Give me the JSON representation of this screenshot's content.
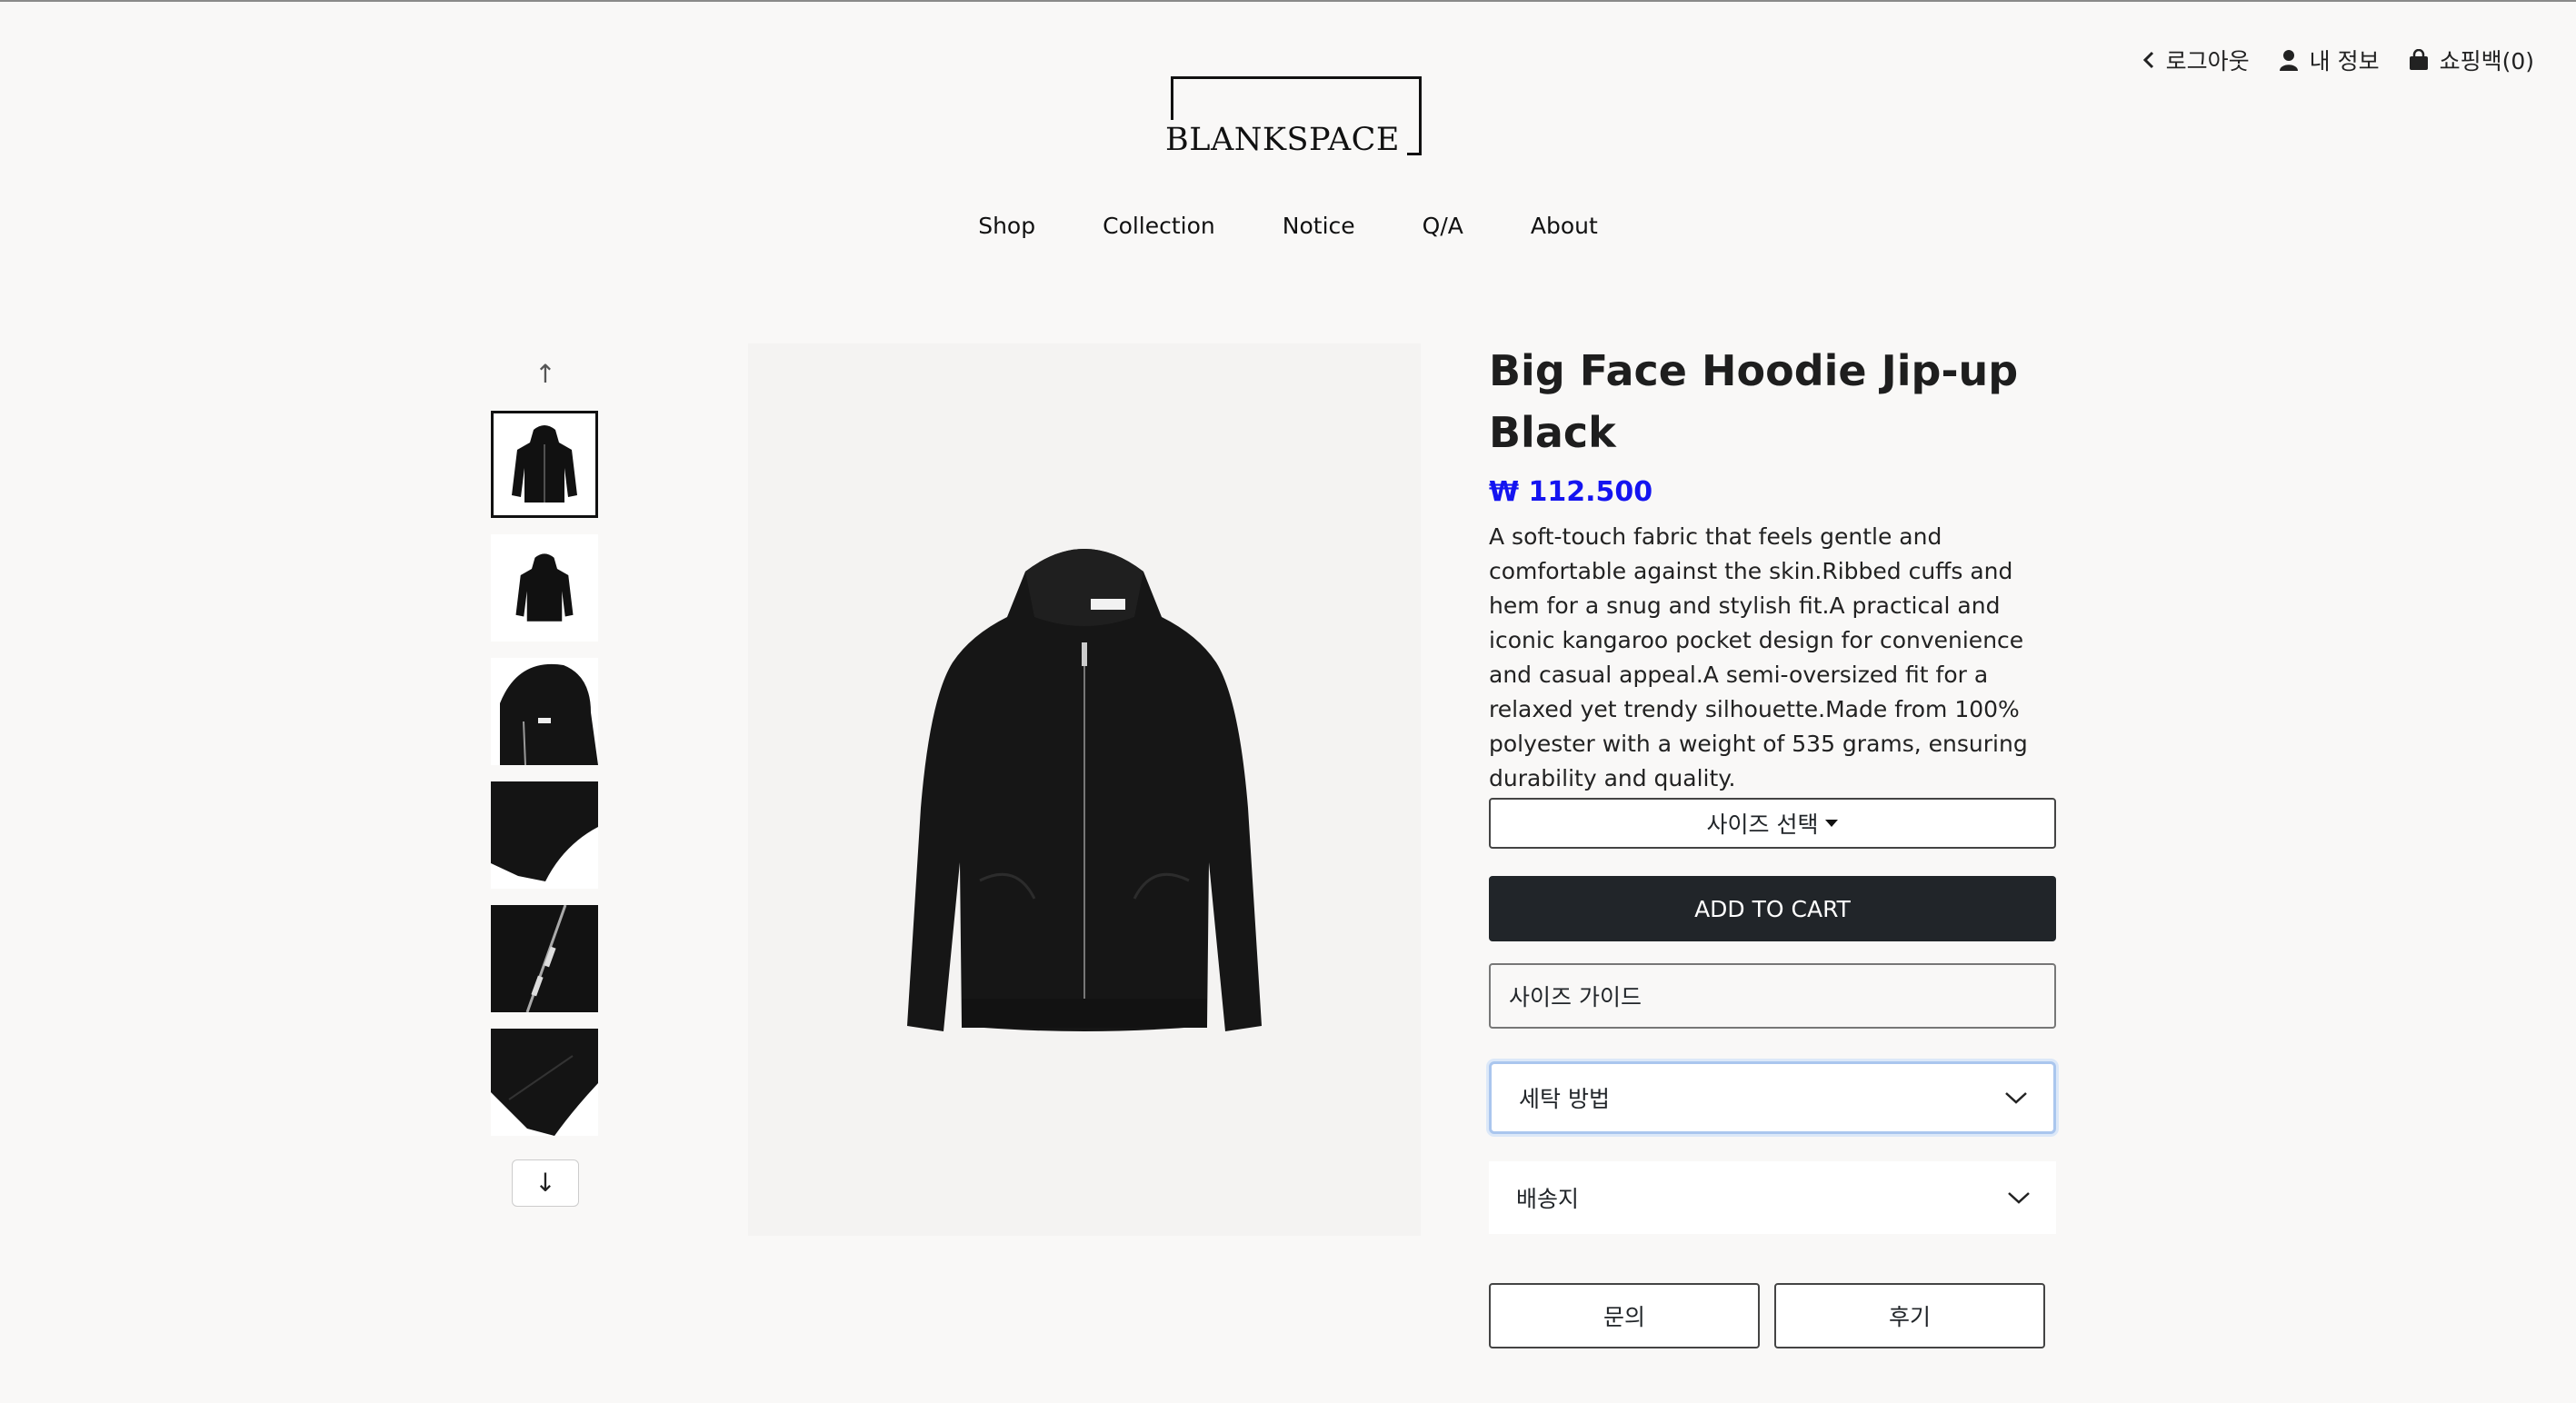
{
  "utility": {
    "logout": "로그아웃",
    "my_info": "내 정보",
    "cart": "쇼핑백(0)"
  },
  "brand": {
    "logo_text": "BLANKSPACE"
  },
  "nav": [
    "Shop",
    "Collection",
    "Notice",
    "Q/A",
    "About"
  ],
  "gallery": {
    "up_arrow": "↑",
    "down_arrow": "↓",
    "thumbnails": [
      "hoodie-front",
      "hoodie-back",
      "hood-detail",
      "hem-detail",
      "zipper-detail",
      "cuff-detail"
    ]
  },
  "product": {
    "title": "Big Face Hoodie Jip-up Black",
    "price": "₩ 112.500",
    "description": "A soft-touch fabric that feels gentle and comfortable against the skin.Ribbed cuffs and hem for a snug and stylish fit.A practical and iconic kangaroo pocket design for convenience and casual appeal.A semi-oversized fit for a relaxed yet trendy silhouette.Made from 100% polyester with a weight of 535 grams, ensuring durability and quality.",
    "size_select": "사이즈 선택",
    "add_to_cart": "ADD TO CART",
    "size_guide": "사이즈 가이드",
    "wash_method": "세탁 방법",
    "shipping": "배송지",
    "inquiry": "문의",
    "review": "후기"
  },
  "colors": {
    "price": "#1414f0",
    "cart_button": "#212529",
    "focus_ring": "#aac6ee"
  }
}
